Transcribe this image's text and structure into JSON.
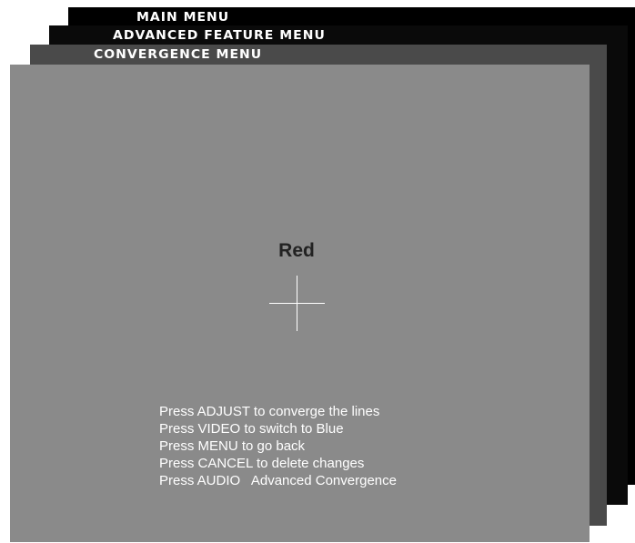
{
  "menus": {
    "main_title": "MAIN MENU",
    "advanced_title": "ADVANCED FEATURE MENU",
    "convergence_title": "CONVERGENCE MENU"
  },
  "screen": {
    "color_label": "Red",
    "instructions": [
      "Press ADJUST to converge the lines",
      "Press VIDEO to switch to Blue",
      "Press MENU to go back",
      "Press CANCEL to delete changes",
      "Press AUDIO   Advanced Convergence"
    ]
  },
  "colors": {
    "main_menu_bg": "#000000",
    "advanced_menu_bg": "#0a0a0a",
    "convergence_menu_bg": "#4a4a4a",
    "screen_bg": "#8a8a8a",
    "crosshair": "#ffffff"
  }
}
